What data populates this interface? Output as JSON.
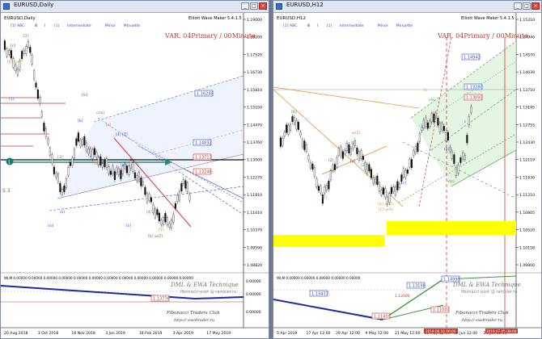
{
  "colors": {
    "accent_red": "#c0392b",
    "accent_blue": "#2e4fd1",
    "accent_green": "#3c9a3c",
    "yellow": "#ffff00",
    "orange": "#e38a2e"
  },
  "left": {
    "window_title": "EURUSD,Daily",
    "header_symbol": "EURUSD,Daily",
    "tool_name": "Elliott Wave Maker 5.4.1.5",
    "tool_modes": [
      "[1] ABC",
      "Ⅲ",
      "I",
      "(1)",
      "Intermediate",
      "Minor",
      "Minuette"
    ],
    "variant": "VAR. 04Primary / 00Minute",
    "price_ticks": [
      "1.19000",
      "1.18200",
      "1.17520",
      "1.16730",
      "1.15810",
      "1.15150",
      "1.14470",
      "1.13760",
      "1.13000",
      "1.12270",
      "1.11810",
      "1.11010",
      "1.10370",
      "1.09590",
      "1.08820"
    ],
    "wave_labels": [
      "[2]",
      "[c]",
      "[b] (a)",
      "[iii]",
      "c(iv)",
      "[b]",
      "[c]",
      "[1]",
      "[3]",
      "[4] [Z]",
      "[5]",
      "[ii]",
      "[4]",
      "(ii)",
      "(B)",
      "[a]",
      "[b] w(Z)",
      "(iii)"
    ],
    "price_boxes": {
      "b1": "1.16249",
      "b2": "1.14832",
      "b3": "1.13713",
      "b4": "1.13248"
    },
    "label_s3": "S 3",
    "indicator_label": "WLM 0.00000 0.00000 0.00000 0.00000 0.00000 0.00000 0.00000 0.00000 0.00000 0.00000 0.00000 0.00000",
    "indicator_values": [
      "0.00000",
      "0.00000",
      "0.00000"
    ],
    "indicator_box": "1.13776",
    "watermark": "DML & EWA Technique",
    "watermark_sub": "fibonacci-post @ rambler.ru",
    "club": "Fibonacci  Traders  Club",
    "club_url": "http:// ewdtrader.ru",
    "date_ticks": [
      "20 Aug 2018",
      "3 Oct 2018",
      "16 Nov 2018",
      "3 Jan 2019",
      "18 Feb 2019",
      "3 Apr 2019",
      "17 May 2019"
    ]
  },
  "right": {
    "window_title": "EURUSD,H12",
    "header_symbol": "EURUSD,H12",
    "tool_name": "Elliott Wave Maker 5.4.1.5",
    "tool_modes": [
      "[1] ABC",
      "Ⅲ",
      "I",
      "(1)",
      "Intermediate",
      "Minor",
      "Minuette"
    ],
    "variant": "VAR. 04Primary / 00Minute",
    "price_ticks": [
      "1.15310",
      "1.14940",
      "1.14570",
      "1.14039",
      "1.13710",
      "1.13195",
      "1.12755",
      "1.12430",
      "1.12119",
      "1.11630",
      "1.11210",
      "1.10805",
      "1.10520",
      "1.10158",
      "1.09800"
    ],
    "wave_labels": [
      "[B]",
      "(1)",
      "(2)",
      "[Z]",
      "w(Z)",
      "[a]",
      "[b]",
      "iii",
      "(b) i",
      "v(c)",
      "(C) v(A)",
      "[c]",
      "(d)",
      "[c] w(Z)",
      "c"
    ],
    "price_boxes": {
      "b1": "1.14942",
      "b2": "1.13280",
      "b3": "1.13093"
    },
    "indicator_label": "WLM 0.00000 0.00000 0.00000 0.00000 0.00000",
    "indicator_boxes": [
      "1.13437",
      "1.13198",
      "1.14998",
      "1.11459",
      "1.11000"
    ],
    "indicator_small": "1.12000",
    "watermark": "DML & EWA Technique",
    "watermark_sub": "fibonacci-post @ rambler.ru",
    "club": "Fibonacci  Traders  Club",
    "club_url": "http:// ewdtrader.ru",
    "date_ticks": [
      "5 Apr 2019",
      "17 Apr 12:00",
      "29 Apr 12:00",
      "9 May 12:00",
      "21 May 12:00",
      "31 May 12:00",
      "12 Jun 12:00",
      "24 Jun 12:00"
    ],
    "red_dates": [
      "2019.06.10 00:00",
      "2019.07.05 08:00"
    ]
  }
}
